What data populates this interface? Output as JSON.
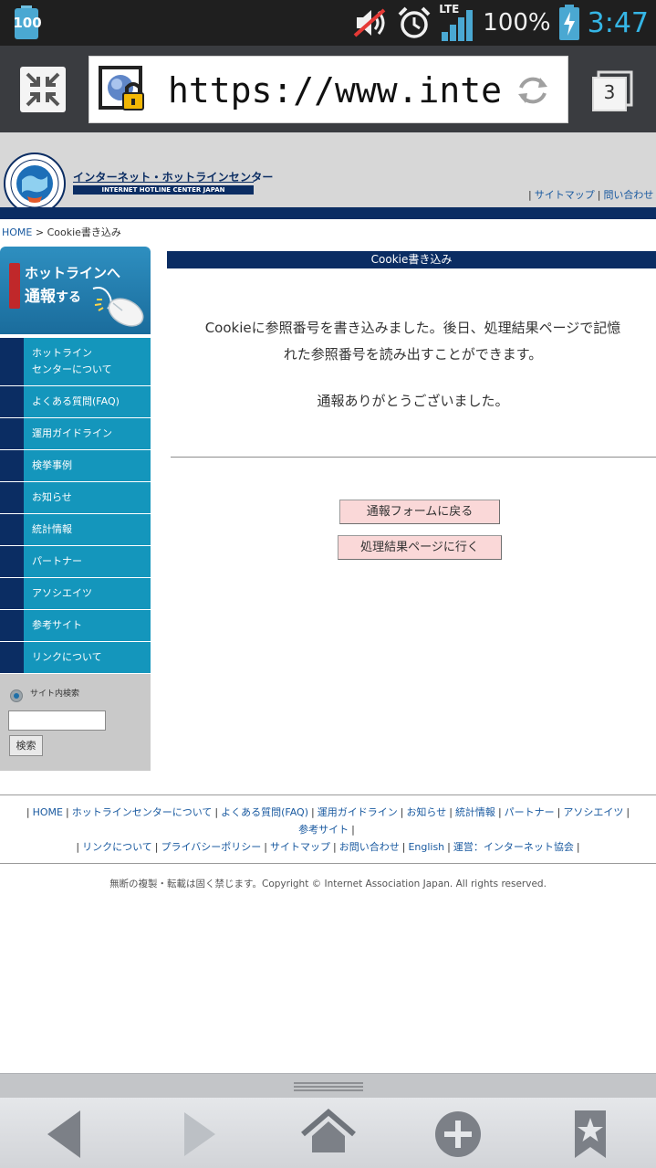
{
  "status_bar": {
    "battery_level_left": "100",
    "network_type": "LTE",
    "battery_percent": "100%",
    "time": "3:47"
  },
  "browser": {
    "url": "https://www.internet",
    "tab_count": "3"
  },
  "site": {
    "logo_title": "インターネット・ホットラインセンター",
    "logo_subtitle": "INTERNET HOTLINE CENTER JAPAN",
    "header_links": [
      "サイトマップ",
      "問い合わせ"
    ]
  },
  "breadcrumb": {
    "home": "HOME",
    "separator": ">",
    "current": "Cookie書き込み"
  },
  "sidebar": {
    "report_banner": {
      "line1": "ホットラインへ",
      "line2_bold": "通報",
      "line2_rest": "する"
    },
    "nav_items": [
      {
        "label_line1": "ホットライン",
        "label_line2": "センターについて"
      },
      {
        "label": "よくある質問(FAQ)"
      },
      {
        "label": "運用ガイドライン"
      },
      {
        "label": "検挙事例"
      },
      {
        "label": "お知らせ"
      },
      {
        "label": "統計情報"
      },
      {
        "label": "パートナー"
      },
      {
        "label": "アソシエイツ"
      },
      {
        "label": "参考サイト"
      },
      {
        "label": "リンクについて"
      }
    ],
    "search": {
      "scope_label": "サイト内検索",
      "input_value": "",
      "button_label": "検索"
    }
  },
  "main": {
    "title": "Cookie書き込み",
    "message_line1": "Cookieに参照番号を書き込みました。後日、処理結果ページで記憶",
    "message_line2": "れた参照番号を読み出すことができます。",
    "thanks": "通報ありがとうございました。",
    "button_back": "通報フォームに戻る",
    "button_result": "処理結果ページに行く"
  },
  "footer": {
    "links_row1": [
      "HOME",
      "ホットラインセンターについて",
      "よくある質問(FAQ)",
      "運用ガイドライン",
      "お知らせ",
      "統計情報",
      "パートナー",
      "アソシエイツ"
    ],
    "links_row2": [
      "参考サイト"
    ],
    "links_row3": [
      "リンクについて",
      "プライバシーポリシー",
      "サイトマップ",
      "お問い合わせ",
      "English",
      "運営：インターネット協会"
    ],
    "copyright": "無断の複製・転載は固く禁じます。Copyright © Internet Association Japan. All rights reserved."
  },
  "colors": {
    "navy": "#0b2d63",
    "nav_cyan": "#1496bc",
    "button_pink": "#fad8d8",
    "time_blue": "#35b6e6",
    "link_blue": "#1a5aa0"
  }
}
